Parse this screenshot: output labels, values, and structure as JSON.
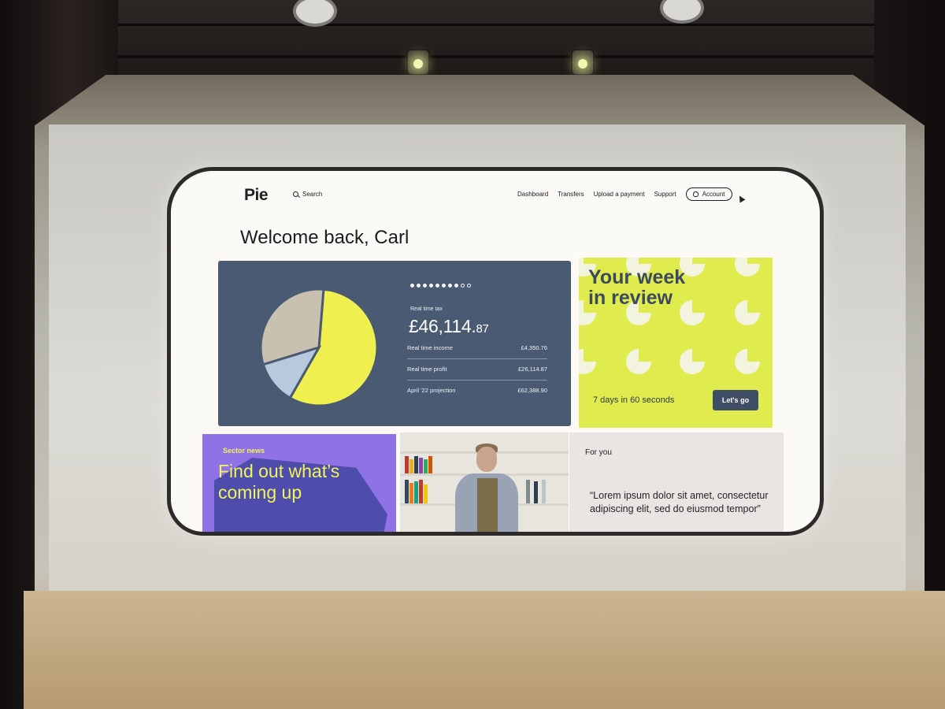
{
  "app": {
    "logo": "Pie"
  },
  "header": {
    "search_label": "Search",
    "nav": [
      "Dashboard",
      "Transfers",
      "Upload a payment",
      "Support"
    ],
    "account_label": "Account"
  },
  "welcome": "Welcome back, Carl",
  "tax_card": {
    "carousel": {
      "total": 10,
      "active": 8
    },
    "label": "Real time tax",
    "value_main": "£46,114.",
    "value_pence": "87",
    "rows": [
      {
        "label": "Real time income",
        "value": "£4,350.76"
      },
      {
        "label": "Real time profit",
        "value": "£26,114.87"
      },
      {
        "label": "April '22 projection",
        "value": "£62,388.90"
      }
    ],
    "colors": {
      "background": "#4a5a72",
      "yellow": "#f0ef50",
      "beige": "#c9c1b0",
      "light_blue": "#b8c9de"
    }
  },
  "chart_data": {
    "type": "pie",
    "values": [
      57,
      12,
      31
    ],
    "colors": [
      "#f0ef50",
      "#b8c9de",
      "#c9c1b0"
    ]
  },
  "week_card": {
    "title_line1": "Your week",
    "title_line2": "in review",
    "subtitle": "7 days in 60 seconds",
    "button": "Let's go",
    "accent": "#e0eb4d"
  },
  "news_card": {
    "tag": "Sector news",
    "title_line1": "Find out what’s",
    "title_line2": "coming up",
    "background": "#8e72e6"
  },
  "for_you_card": {
    "title": "For you",
    "quote": "“Lorem ipsum dolor sit amet, consectetur adipiscing elit, sed do eiusmod tempor”"
  }
}
